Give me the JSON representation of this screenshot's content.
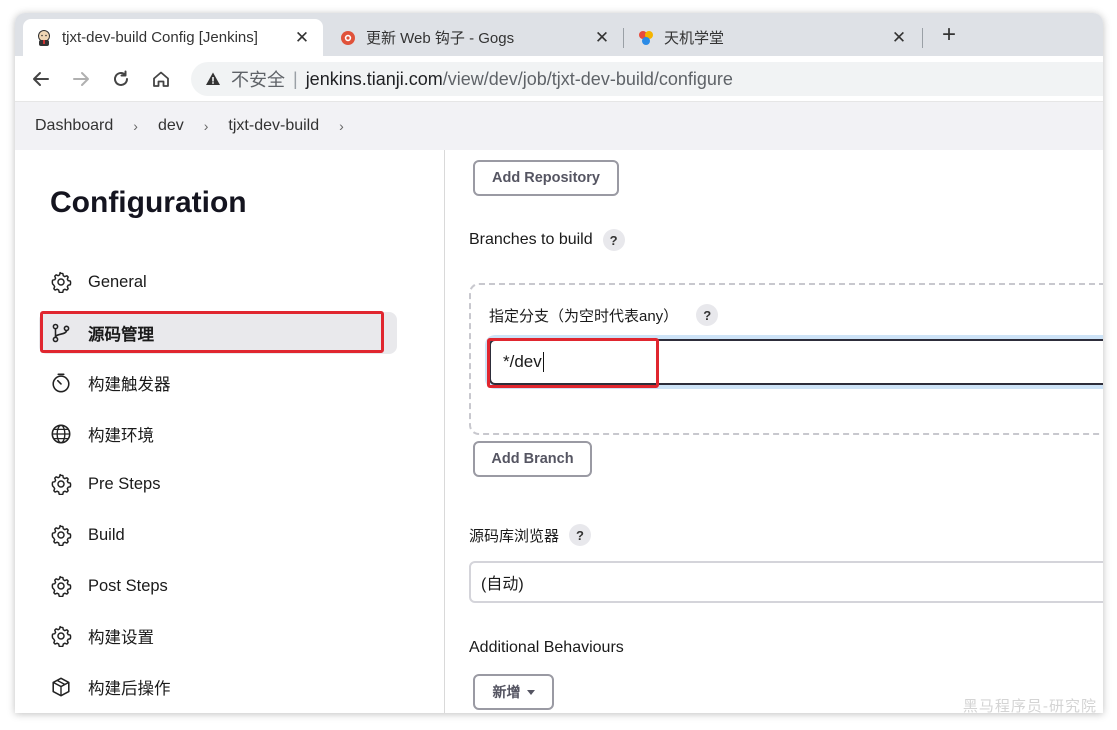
{
  "browser": {
    "tabs": [
      {
        "title": "tjxt-dev-build Config [Jenkins]",
        "close": "✕"
      },
      {
        "title": "更新 Web 钩子 - Gogs",
        "close": "✕"
      },
      {
        "title": "天机学堂",
        "close": "✕"
      }
    ],
    "new_tab": "+",
    "address": {
      "security_label": "不安全",
      "separator": "|",
      "host": "jenkins.tianji.com",
      "path": "/view/dev/job/tjxt-dev-build/configure"
    }
  },
  "breadcrumb": {
    "items": [
      "Dashboard",
      "dev",
      "tjxt-dev-build"
    ],
    "separator": "›"
  },
  "sidebar": {
    "title": "Configuration",
    "items": [
      {
        "label": "General",
        "icon": "gear-icon"
      },
      {
        "label": "源码管理",
        "icon": "git-branch-icon",
        "active": true
      },
      {
        "label": "构建触发器",
        "icon": "timer-icon"
      },
      {
        "label": "构建环境",
        "icon": "globe-icon"
      },
      {
        "label": "Pre Steps",
        "icon": "gear-icon"
      },
      {
        "label": "Build",
        "icon": "gear-icon"
      },
      {
        "label": "Post Steps",
        "icon": "gear-icon"
      },
      {
        "label": "构建设置",
        "icon": "gear-icon"
      },
      {
        "label": "构建后操作",
        "icon": "package-icon"
      }
    ]
  },
  "main": {
    "add_repository": "Add Repository",
    "branches_label": "Branches to build",
    "branch_specifier_label": "指定分支（为空时代表any）",
    "branch_value": "*/dev",
    "add_branch": "Add Branch",
    "repo_browser_label": "源码库浏览器",
    "repo_browser_value": "(自动)",
    "additional_behaviours_label": "Additional Behaviours",
    "add_behaviour_button": "新增",
    "help_glyph": "?"
  },
  "watermark": "黑马程序员-研究院",
  "colors": {
    "highlight_red": "#e0262f",
    "tab_strip": "#dee1e6",
    "breadcrumb_bg": "#f2f2f5",
    "active_item_bg": "#e9e9ec"
  }
}
